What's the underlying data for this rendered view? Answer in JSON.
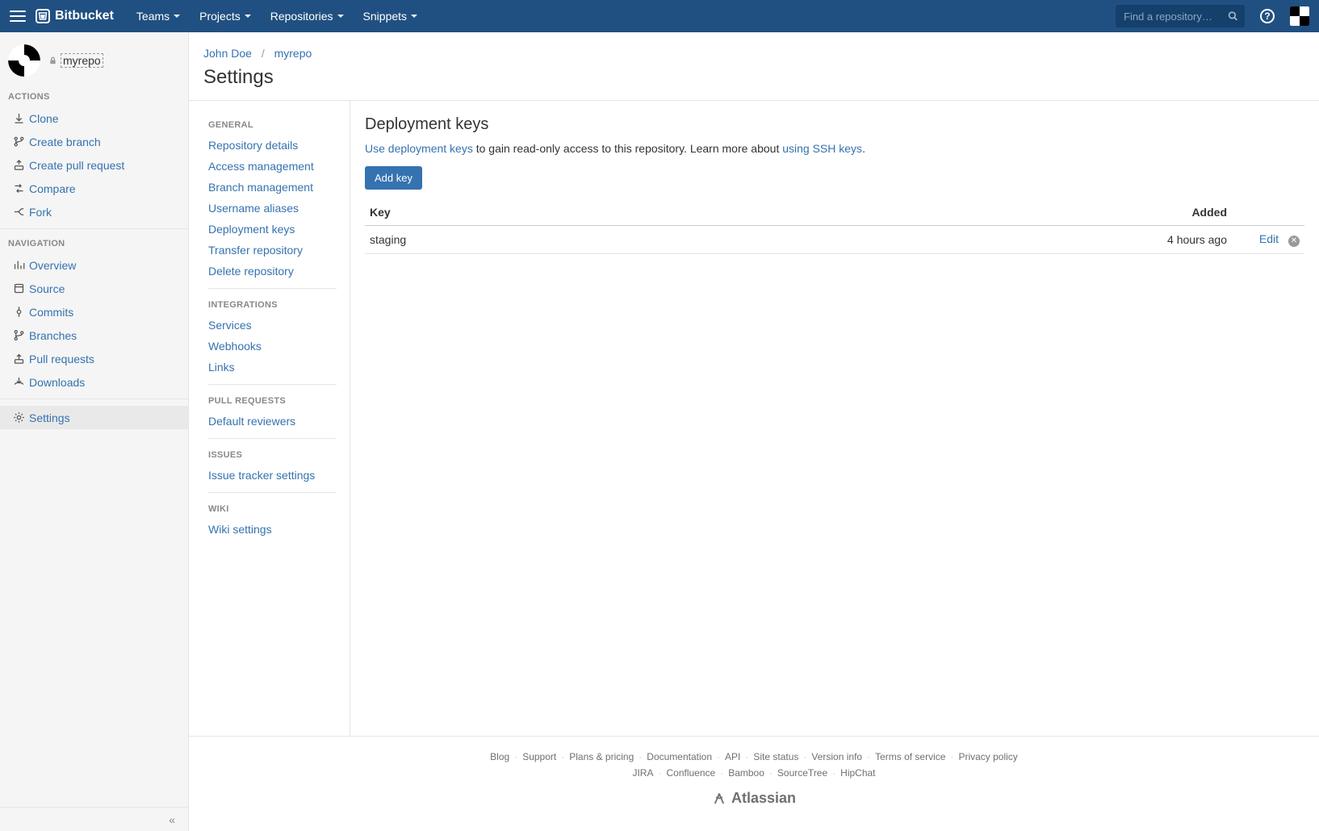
{
  "topbar": {
    "brand": "Bitbucket",
    "menu": [
      "Teams",
      "Projects",
      "Repositories",
      "Snippets"
    ],
    "search_placeholder": "Find a repository…"
  },
  "repo": {
    "name": "myrepo",
    "private": true
  },
  "sidebar": {
    "actions_heading": "ACTIONS",
    "actions": [
      {
        "key": "clone",
        "label": "Clone"
      },
      {
        "key": "create-branch",
        "label": "Create branch"
      },
      {
        "key": "create-pr",
        "label": "Create pull request"
      },
      {
        "key": "compare",
        "label": "Compare"
      },
      {
        "key": "fork",
        "label": "Fork"
      }
    ],
    "navigation_heading": "NAVIGATION",
    "navigation": [
      {
        "key": "overview",
        "label": "Overview"
      },
      {
        "key": "source",
        "label": "Source"
      },
      {
        "key": "commits",
        "label": "Commits"
      },
      {
        "key": "branches",
        "label": "Branches"
      },
      {
        "key": "pull-requests",
        "label": "Pull requests"
      },
      {
        "key": "downloads",
        "label": "Downloads"
      }
    ],
    "settings_label": "Settings"
  },
  "breadcrumb": {
    "owner": "John Doe",
    "repo": "myrepo"
  },
  "page_title": "Settings",
  "settings_nav": {
    "groups": [
      {
        "heading": "GENERAL",
        "items": [
          "Repository details",
          "Access management",
          "Branch management",
          "Username aliases",
          "Deployment keys",
          "Transfer repository",
          "Delete repository"
        ]
      },
      {
        "heading": "INTEGRATIONS",
        "items": [
          "Services",
          "Webhooks",
          "Links"
        ]
      },
      {
        "heading": "PULL REQUESTS",
        "items": [
          "Default reviewers"
        ]
      },
      {
        "heading": "ISSUES",
        "items": [
          "Issue tracker settings"
        ]
      },
      {
        "heading": "WIKI",
        "items": [
          "Wiki settings"
        ]
      }
    ]
  },
  "panel": {
    "title": "Deployment keys",
    "desc_link1": "Use deployment keys",
    "desc_mid": " to gain read-only access to this repository. Learn more about ",
    "desc_link2": "using SSH keys",
    "desc_tail": ".",
    "add_button": "Add key",
    "columns": {
      "key": "Key",
      "added": "Added"
    },
    "rows": [
      {
        "name": "staging",
        "added": "4 hours ago",
        "edit": "Edit"
      }
    ]
  },
  "footer": {
    "row1": [
      "Blog",
      "Support",
      "Plans & pricing",
      "Documentation",
      "API",
      "Site status",
      "Version info",
      "Terms of service",
      "Privacy policy"
    ],
    "row2": [
      "JIRA",
      "Confluence",
      "Bamboo",
      "SourceTree",
      "HipChat"
    ],
    "brand": "Atlassian"
  }
}
